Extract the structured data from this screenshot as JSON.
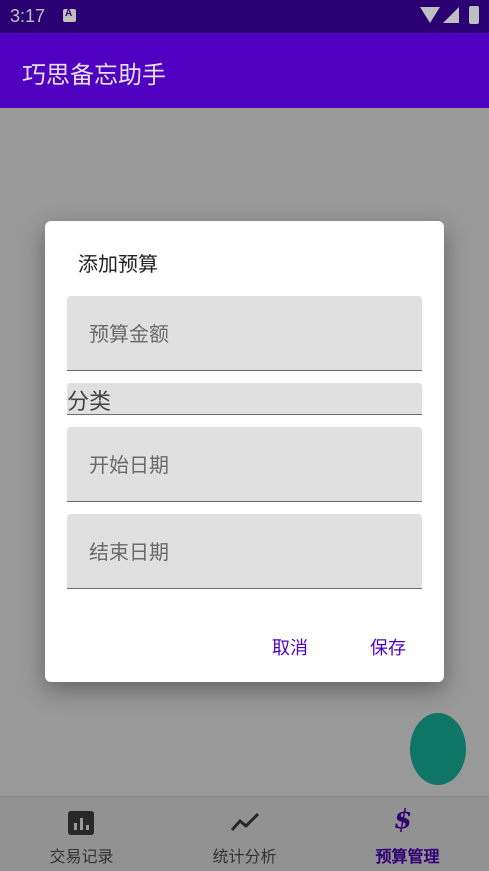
{
  "status_bar": {
    "time": "3:17"
  },
  "app_bar": {
    "title": "巧思备忘助手"
  },
  "dialog": {
    "title": "添加预算",
    "fields": {
      "amount_hint": "预算金额",
      "category_label": "分类",
      "start_hint": "开始日期",
      "end_hint": "结束日期"
    },
    "buttons": {
      "cancel": "取消",
      "save": "保存"
    }
  },
  "bottom_nav": {
    "items": [
      {
        "label": "交易记录",
        "icon": "bar-chart-icon"
      },
      {
        "label": "统计分析",
        "icon": "trend-line-icon"
      },
      {
        "label": "预算管理",
        "icon": "dollar-icon",
        "active": true
      }
    ]
  },
  "colors": {
    "primary": "#5000c0",
    "status_bar": "#3a0098",
    "fab": "#19c3a8"
  }
}
